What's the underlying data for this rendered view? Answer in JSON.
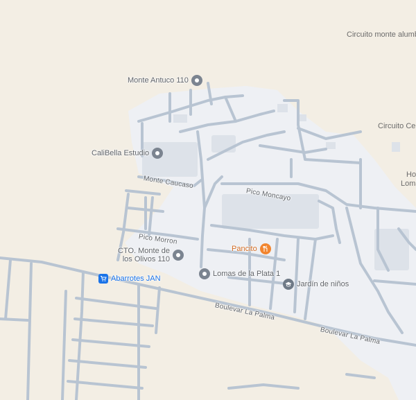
{
  "map": {
    "colors": {
      "land": "#f3eee4",
      "urban": "#eef0f4",
      "road": "#b8c4d2",
      "block": "#dde2e9",
      "food_poi": "#f2852f",
      "shop_poi": "#1a73e8",
      "generic_poi": "#7b8490",
      "label_text": "#5f6368"
    },
    "places": [
      {
        "name": "Circuito monte alumb",
        "icon": "none"
      },
      {
        "name": "Circuito Cer",
        "icon": "none"
      },
      {
        "name": "Ho",
        "icon": "none"
      },
      {
        "name": "Loma",
        "icon": "none"
      }
    ],
    "pois": [
      {
        "name": "Monte Antuco 110",
        "icon": "place-pin-icon"
      },
      {
        "name": "CaliBella Estudio",
        "icon": "place-pin-icon"
      },
      {
        "name": "CTO. Monte de los Olivos 110",
        "line1": "CTO. Monte de",
        "line2": "los Olivos 110",
        "icon": "place-pin-icon"
      },
      {
        "name": "Lomas de la Plata 1",
        "icon": "place-pin-icon"
      },
      {
        "name": "Pancito",
        "icon": "restaurant-icon"
      },
      {
        "name": "Jardín de niños",
        "icon": "school-icon"
      },
      {
        "name": "Abarrotes JAN",
        "icon": "shopping-cart-icon"
      }
    ],
    "streets": [
      {
        "name": "Monte Caucaso"
      },
      {
        "name": "Pico Moncayo"
      },
      {
        "name": "Pico Morron"
      },
      {
        "name": "Boulevar La Palma"
      },
      {
        "name": "Boulevar La Palma"
      }
    ]
  }
}
